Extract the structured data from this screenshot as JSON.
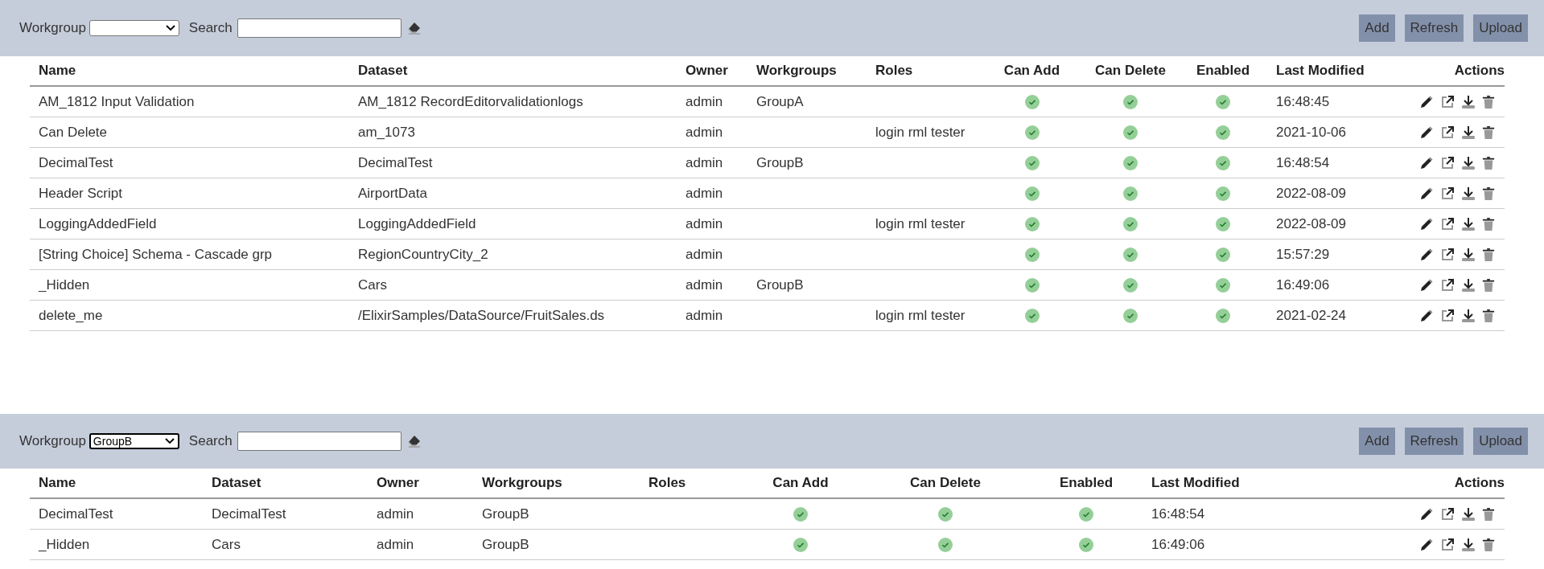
{
  "panels": [
    {
      "toolbar": {
        "workgroup_label": "Workgroup",
        "search_label": "Search",
        "buttons": [
          "Add",
          "Refresh",
          "Upload"
        ]
      },
      "table": {
        "columns": [
          {
            "label": "Name",
            "kind": "text"
          },
          {
            "label": "Dataset",
            "kind": "text"
          },
          {
            "label": "Owner",
            "kind": "text"
          },
          {
            "label": "Workgroups",
            "kind": "text"
          },
          {
            "label": "Roles",
            "kind": "text"
          },
          {
            "label": "Can Add",
            "kind": "check"
          },
          {
            "label": "Can Delete",
            "kind": "check"
          },
          {
            "label": "Enabled",
            "kind": "check"
          },
          {
            "label": "Last Modified",
            "kind": "text"
          },
          {
            "label": "Actions",
            "kind": "actions"
          }
        ],
        "rows": [
          {
            "name": "AM_1812 Input Validation",
            "dataset": "AM_1812 RecordEditorvalidationlogs",
            "owner": "admin",
            "workgroups": "GroupA",
            "can_add": true,
            "can_delete": true,
            "enabled": true,
            "last_modified": "16:48:45"
          },
          {
            "name": "Can Delete",
            "dataset": "am_1073",
            "owner": "admin",
            "roles": "login rml tester",
            "can_add": true,
            "can_delete": true,
            "enabled": true,
            "last_modified": "2021-10-06"
          },
          {
            "name": "DecimalTest",
            "dataset": "DecimalTest",
            "owner": "admin",
            "workgroups": "GroupB",
            "can_add": true,
            "can_delete": true,
            "enabled": true,
            "last_modified": "16:48:54"
          },
          {
            "name": "Header Script",
            "dataset": "AirportData",
            "owner": "admin",
            "can_add": true,
            "can_delete": true,
            "enabled": true,
            "last_modified": "2022-08-09"
          },
          {
            "name": "LoggingAddedField",
            "dataset": "LoggingAddedField",
            "owner": "admin",
            "roles": "login rml tester",
            "can_add": true,
            "can_delete": true,
            "enabled": true,
            "last_modified": "2022-08-09"
          },
          {
            "name": "[String Choice] Schema - Cascade grp",
            "dataset": "RegionCountryCity_2",
            "owner": "admin",
            "can_add": true,
            "can_delete": true,
            "enabled": true,
            "last_modified": "15:57:29"
          },
          {
            "name": "_Hidden",
            "dataset": "Cars",
            "owner": "admin",
            "workgroups": "GroupB",
            "can_add": true,
            "can_delete": true,
            "enabled": true,
            "last_modified": "16:49:06"
          },
          {
            "name": "delete_me",
            "dataset": "/ElixirSamples/DataSource/FruitSales.ds",
            "owner": "admin",
            "roles": "login rml tester",
            "can_add": true,
            "can_delete": true,
            "enabled": true,
            "last_modified": "2021-02-24"
          }
        ]
      }
    },
    {
      "toolbar": {
        "workgroup_label": "Workgroup",
        "workgroup_select": {
          "value": "GroupB"
        },
        "search_label": "Search",
        "buttons": [
          "Add",
          "Refresh",
          "Upload"
        ]
      },
      "table": {
        "columns": [
          {
            "label": "Name",
            "kind": "text"
          },
          {
            "label": "Dataset",
            "kind": "text"
          },
          {
            "label": "Owner",
            "kind": "text"
          },
          {
            "label": "Workgroups",
            "kind": "text"
          },
          {
            "label": "Roles",
            "kind": "text"
          },
          {
            "label": "Can Add",
            "kind": "check"
          },
          {
            "label": "Can Delete",
            "kind": "check"
          },
          {
            "label": "Enabled",
            "kind": "check"
          },
          {
            "label": "Last Modified",
            "kind": "text"
          },
          {
            "label": "Actions",
            "kind": "actions"
          }
        ],
        "rows": [
          {
            "name": "DecimalTest",
            "dataset": "DecimalTest",
            "owner": "admin",
            "workgroups": "GroupB",
            "can_add": true,
            "can_delete": true,
            "enabled": true,
            "last_modified": "16:48:54"
          },
          {
            "name": "_Hidden",
            "dataset": "Cars",
            "owner": "admin",
            "workgroups": "GroupB",
            "can_add": true,
            "can_delete": true,
            "enabled": true,
            "last_modified": "16:49:06"
          }
        ]
      }
    }
  ]
}
